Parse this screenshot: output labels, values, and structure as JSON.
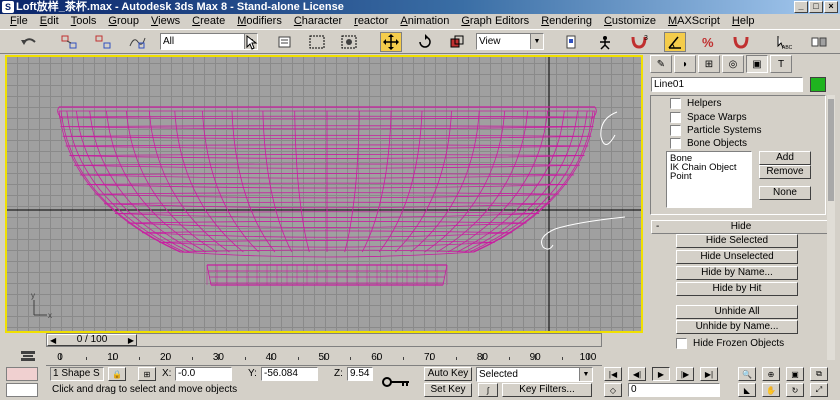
{
  "window": {
    "title": "Loft放样_茶杯.max - Autodesk 3ds Max 8  - Stand-alone License"
  },
  "menu": [
    "File",
    "Edit",
    "Tools",
    "Group",
    "Views",
    "Create",
    "Modifiers",
    "Character",
    "reactor",
    "Animation",
    "Graph Editors",
    "Rendering",
    "Customize",
    "MAXScript",
    "Help"
  ],
  "toolbar": {
    "selection_filter": "All",
    "reference_coord": "View",
    "snap_angle_label": "3",
    "snap_label": "3"
  },
  "viewport": {
    "border_color": "#f0e000",
    "grid_color": "#8a8a8a",
    "bg_color": "#a0a0a0",
    "object_color": "#c81ea0",
    "handle_color": "#ffffff",
    "axis_labels": {
      "x": "x",
      "y": "y"
    }
  },
  "command_panel": {
    "object_name": "Line01",
    "object_color": "#1fb41f",
    "checkboxes": [
      "Helpers",
      "Space Warps",
      "Particle Systems",
      "Bone Objects"
    ],
    "list_items": [
      "Bone",
      "IK Chain Object",
      "Point"
    ],
    "list_buttons": [
      "Add",
      "Remove",
      "None"
    ],
    "rollout_title": "Hide",
    "rollout_minus": "-",
    "hide_buttons": [
      "Hide Selected",
      "Hide Unselected",
      "Hide by Name...",
      "Hide by Hit"
    ],
    "unhide_buttons": [
      "Unhide All",
      "Unhide by Name..."
    ],
    "hide_frozen_label": "Hide Frozen Objects"
  },
  "timeline": {
    "slider_label": "0 / 100",
    "ruler_ticks": [
      0,
      10,
      20,
      30,
      40,
      50,
      60,
      70,
      80,
      90,
      100
    ]
  },
  "status": {
    "selection_count": "1 Shape S",
    "x_label": "X:",
    "x_value": "-0.0",
    "y_label": "Y:",
    "y_value": "-56.084",
    "z_label": "Z:",
    "z_value": "9.54",
    "auto_key": "Auto Key",
    "set_key": "Set Key",
    "key_mode": "Selected",
    "key_filters": "Key Filters...",
    "prompt": "Click and drag to select and move objects",
    "frame_value": "0"
  }
}
